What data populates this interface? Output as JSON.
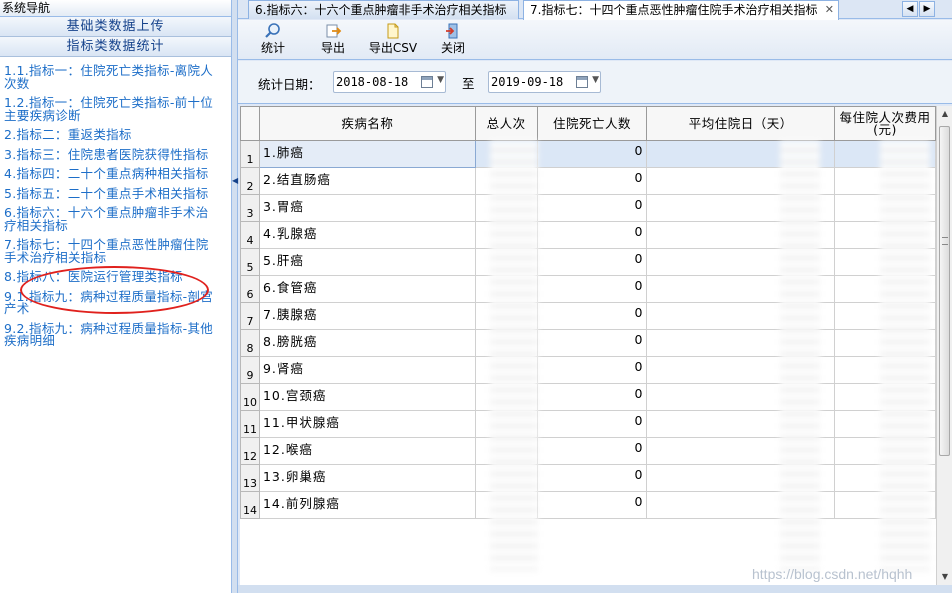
{
  "nav": {
    "header": "系统导航",
    "sections": [
      "基础类数据上传",
      "指标类数据统计"
    ],
    "items": [
      "1.1.指标一：住院死亡类指标-离院人次数",
      "1.2.指标一：住院死亡类指标-前十位主要疾病诊断",
      "2.指标二：重返类指标",
      "3.指标三：住院患者医院获得性指标",
      "4.指标四：二十个重点病种相关指标",
      "5.指标五：二十个重点手术相关指标",
      "6.指标六：十六个重点肿瘤非手术治疗相关指标",
      "7.指标七：十四个重点恶性肿瘤住院手术治疗相关指标",
      "8.指标八：医院运行管理类指标",
      "9.1.指标九：病种过程质量指标-剖宫产术",
      "9.2.指标九：病种过程质量指标-其他疾病明细"
    ]
  },
  "tabs": [
    {
      "label": "6.指标六：十六个重点肿瘤非手术治疗相关指标",
      "active": false
    },
    {
      "label": "7.指标七：十四个重点恶性肿瘤住院手术治疗相关指标",
      "active": true
    }
  ],
  "toolbar": {
    "stat_label": "统计",
    "export_label": "导出",
    "export_csv_label": "导出CSV",
    "close_label": "关闭"
  },
  "filter": {
    "date_label": "统计日期：",
    "from": "2018-08-18",
    "separator": "至",
    "to": "2019-09-18"
  },
  "table": {
    "headers": [
      "疾病名称",
      "总人次",
      "住院死亡人数",
      "平均住院日（天）",
      "每住院人次费用(元)"
    ],
    "rows": [
      {
        "num": "1",
        "name": "1.肺癌",
        "deaths": "0"
      },
      {
        "num": "2",
        "name": "2.结直肠癌",
        "deaths": "0"
      },
      {
        "num": "3",
        "name": "3.胃癌",
        "deaths": "0"
      },
      {
        "num": "4",
        "name": "4.乳腺癌",
        "deaths": "0"
      },
      {
        "num": "5",
        "name": "5.肝癌",
        "deaths": "0"
      },
      {
        "num": "6",
        "name": "6.食管癌",
        "deaths": "0"
      },
      {
        "num": "7",
        "name": "7.胰腺癌",
        "deaths": "0"
      },
      {
        "num": "8",
        "name": "8.膀胱癌",
        "deaths": "0"
      },
      {
        "num": "9",
        "name": "9.肾癌",
        "deaths": "0"
      },
      {
        "num": "10",
        "name": "10.宫颈癌",
        "deaths": "0"
      },
      {
        "num": "11",
        "name": "11.甲状腺癌",
        "deaths": "0"
      },
      {
        "num": "12",
        "name": "12.喉癌",
        "deaths": "0"
      },
      {
        "num": "13",
        "name": "13.卵巢癌",
        "deaths": "0"
      },
      {
        "num": "14",
        "name": "14.前列腺癌",
        "deaths": "0"
      }
    ]
  },
  "watermark": "https://blog.csdn.net/hqhh",
  "colors": {
    "nav_link": "#1d6ec8",
    "highlight": "#e0211d",
    "border": "#99bbe8"
  }
}
